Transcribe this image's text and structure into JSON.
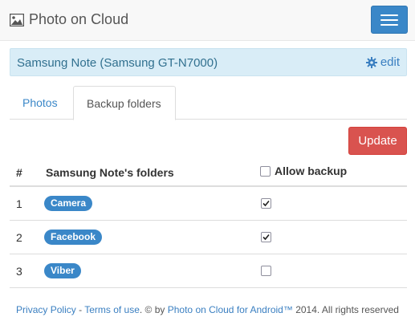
{
  "navbar": {
    "brand_icon": "image-icon",
    "brand_title": "Photo on Cloud",
    "menu_icon": "hamburger-icon"
  },
  "device": {
    "name": "Samsung Note (Samsung GT-N7000)",
    "edit_icon": "gear-icon",
    "edit_label": "edit"
  },
  "tabs": [
    {
      "label": "Photos",
      "active": false
    },
    {
      "label": "Backup folders",
      "active": true
    }
  ],
  "toolbar": {
    "update_label": "Update"
  },
  "table": {
    "headers": [
      "#",
      "Samsung Note's folders",
      "Allow backup"
    ],
    "rows": [
      {
        "num": "1",
        "folder": "Camera",
        "allow": true
      },
      {
        "num": "2",
        "folder": "Facebook",
        "allow": true
      },
      {
        "num": "3",
        "folder": "Viber",
        "allow": false
      }
    ]
  },
  "footer": {
    "privacy": "Privacy Policy",
    "sep": " - ",
    "terms": "Terms of use",
    "copy_prefix": ". © by ",
    "app_link": "Photo on Cloud for Android™",
    "copy_suffix": " 2014. All rights reserved"
  },
  "colors": {
    "accent": "#3a87c8",
    "danger": "#d9534f",
    "info_bg": "#d9edf7"
  }
}
